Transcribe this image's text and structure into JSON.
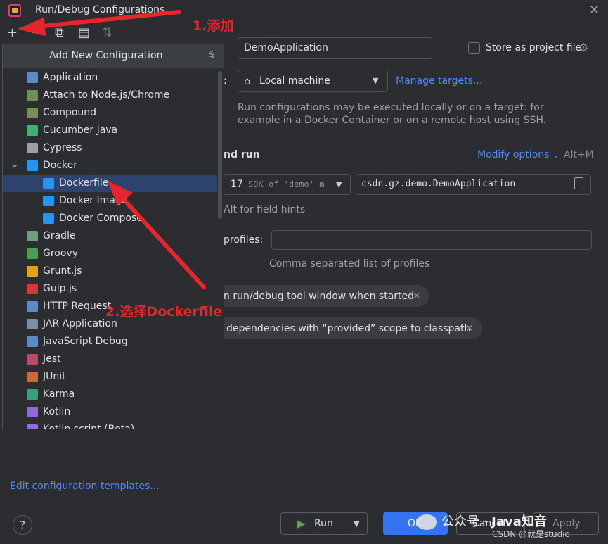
{
  "window": {
    "title": "Run/Debug Configurations",
    "close": "✕"
  },
  "toolbar": {
    "add": "+",
    "remove": "−",
    "copy": "⧉",
    "folder": "▤",
    "sort": "⇅"
  },
  "popup": {
    "title": "Add New Configuration",
    "items": [
      {
        "label": "Application",
        "icon": "application-icon",
        "color": "#5b8ac6"
      },
      {
        "label": "Attach to Node.js/Chrome",
        "icon": "nodejs-icon",
        "color": "#6e8f55"
      },
      {
        "label": "Compound",
        "icon": "compound-icon",
        "color": "#7d8d5a"
      },
      {
        "label": "Cucumber Java",
        "icon": "cucumber-icon",
        "color": "#3bb371"
      },
      {
        "label": "Cypress",
        "icon": "cypress-icon",
        "color": "#9da0a8"
      },
      {
        "label": "Docker",
        "icon": "docker-icon",
        "color": "#2496ed"
      },
      {
        "label": "Dockerfile",
        "icon": "docker-icon",
        "color": "#2496ed"
      },
      {
        "label": "Docker Image",
        "icon": "docker-icon",
        "color": "#2496ed"
      },
      {
        "label": "Docker Compose",
        "icon": "docker-icon",
        "color": "#2496ed"
      },
      {
        "label": "Gradle",
        "icon": "gradle-icon",
        "color": "#6c9f7d"
      },
      {
        "label": "Groovy",
        "icon": "groovy-icon",
        "color": "#4a9d52"
      },
      {
        "label": "Grunt.js",
        "icon": "grunt-icon",
        "color": "#e4a125"
      },
      {
        "label": "Gulp.js",
        "icon": "gulp-icon",
        "color": "#d9383a"
      },
      {
        "label": "HTTP Request",
        "icon": "http-icon",
        "color": "#5b8ac6"
      },
      {
        "label": "JAR Application",
        "icon": "jar-icon",
        "color": "#7a8ea8"
      },
      {
        "label": "JavaScript Debug",
        "icon": "js-debug-icon",
        "color": "#5b8ac6"
      },
      {
        "label": "Jest",
        "icon": "jest-icon",
        "color": "#b84b6a"
      },
      {
        "label": "JUnit",
        "icon": "junit-icon",
        "color": "#c96a3a"
      },
      {
        "label": "Karma",
        "icon": "karma-icon",
        "color": "#3aa07a"
      },
      {
        "label": "Kotlin",
        "icon": "kotlin-icon",
        "color": "#8e6bd8"
      },
      {
        "label": "Kotlin script (Beta)",
        "icon": "kotlin-icon",
        "color": "#8e6bd8"
      }
    ]
  },
  "left": {
    "edit_templates": "Edit configuration templates...",
    "help": "?"
  },
  "form": {
    "name_value": "DemoApplication",
    "store_label": "Store as project file",
    "run_on_label": ":",
    "target_value": "Local machine",
    "manage_targets": "Manage targets...",
    "hint_line1": "Run configurations may be executed locally or on a target: for",
    "hint_line2": "example in a Docker Container or on a remote host using SSH.",
    "section": "nd run",
    "modify_options": "Modify options",
    "modify_shortcut": "Alt+M",
    "jdk_num": "17",
    "jdk_text": " SDK of 'demo' m",
    "main_class": "csdn.gz.demo.DemoApplication",
    "field_hint": "Alt for field hints",
    "profiles_label": "profiles:",
    "profiles_hint": "Comma separated list of profiles",
    "chip1": "n run/debug tool window when started",
    "chip2": "dependencies with “provided” scope to classpath",
    "chip_close": "✕"
  },
  "buttons": {
    "run": "Run",
    "ok": "OK",
    "cancel": "Cancel",
    "apply": "Apply"
  },
  "annotations": {
    "step1": "1.添加",
    "step2": "2.选择Dockerfile"
  },
  "watermark": {
    "wechat_prefix": "公众号 · ",
    "wechat_name": "Java知音",
    "csdn": "CSDN @就是studio"
  }
}
